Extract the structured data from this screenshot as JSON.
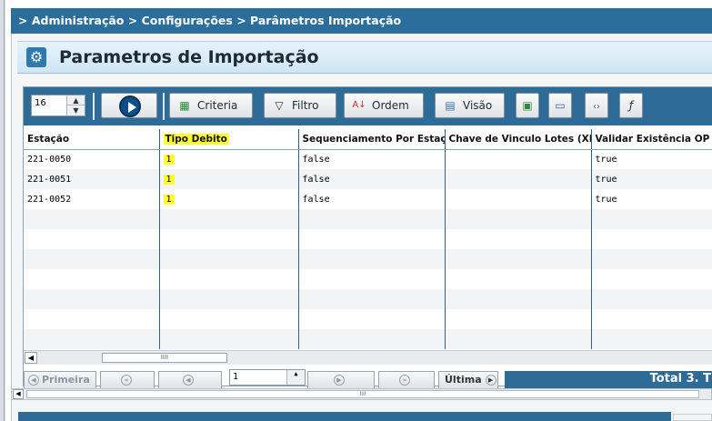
{
  "breadcrumb": "> Administração > Configurações > Parâmetros Importação",
  "title": "Parametros de Importação",
  "toolbar": {
    "page_size": "16",
    "criteria_label": "Criteria",
    "filtro_label": "Filtro",
    "ordem_label": "Ordem",
    "visao_label": "Visão"
  },
  "grid": {
    "columns": [
      "Estação",
      "Tipo Debito",
      "Sequenciamento Por Estação",
      "Chave de Vinculo Lotes (XL",
      "Validar Existência OP"
    ],
    "rows": [
      {
        "estacao": "221-0050",
        "tipo_debito": "1",
        "sequenciamento": "false",
        "chave": "",
        "validar": "true"
      },
      {
        "estacao": "221-0051",
        "tipo_debito": "1",
        "sequenciamento": "false",
        "chave": "",
        "validar": "true"
      },
      {
        "estacao": "221-0052",
        "tipo_debito": "1",
        "sequenciamento": "false",
        "chave": "",
        "validar": "true"
      }
    ]
  },
  "pager": {
    "first_label": "Primeira",
    "last_label": "Última",
    "page_value": "1",
    "total_label": "Total 3. T"
  }
}
